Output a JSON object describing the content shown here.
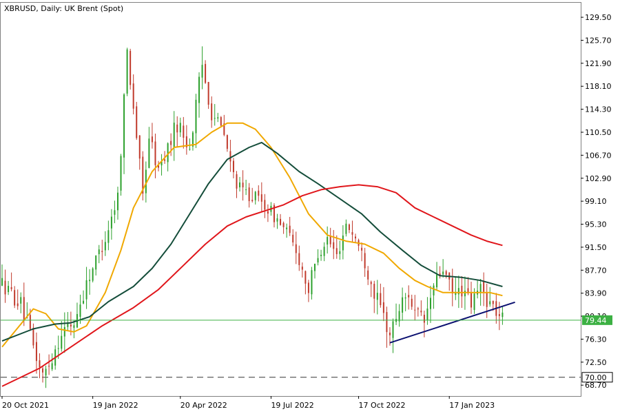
{
  "chart_data": {
    "type": "candlestick",
    "title": "XBRUSD, Daily:  UK Brent (Spot)",
    "x_tick_labels": [
      "20 Oct 2021",
      "19 Jan 2022",
      "20 Apr 2022",
      "19 Jul 2022",
      "17 Oct 2022",
      "17 Jan 2023"
    ],
    "y_tick_labels": [
      "129.50",
      "125.70",
      "121.90",
      "118.10",
      "114.30",
      "110.50",
      "106.70",
      "102.90",
      "99.10",
      "95.30",
      "91.50",
      "87.70",
      "83.90",
      "80.10",
      "76.30",
      "72.50",
      "68.70"
    ],
    "ylim": [
      66.9,
      131.9
    ],
    "price_tag": {
      "label": "79.44",
      "value": 79.44
    },
    "level_tag": {
      "label": "70.00",
      "value": 70.0
    },
    "colors": {
      "bull": "#2ca02c",
      "bear": "#c0392b",
      "ma_fast": "#f0a800",
      "ma_mid": "#144d3a",
      "ma_slow": "#e0161b",
      "trendline": "#0b1070",
      "price_line": "#3cb043",
      "level_line": "#333333"
    },
    "price_path": [
      [
        0,
        85.5
      ],
      [
        6,
        82.0
      ],
      [
        10,
        75.0
      ],
      [
        13,
        70.0
      ],
      [
        16,
        73.5
      ],
      [
        19,
        77.5
      ],
      [
        23,
        79.0
      ],
      [
        28,
        87.0
      ],
      [
        33,
        93.0
      ],
      [
        37,
        100.0
      ],
      [
        40,
        124.0
      ],
      [
        42,
        115.0
      ],
      [
        45,
        100.0
      ],
      [
        47,
        110.0
      ],
      [
        50,
        104.0
      ],
      [
        53,
        108.0
      ],
      [
        56,
        112.0
      ],
      [
        60,
        108.0
      ],
      [
        64,
        121.5
      ],
      [
        67,
        114.0
      ],
      [
        71,
        110.0
      ],
      [
        73,
        105.0
      ],
      [
        76,
        101.0
      ],
      [
        80,
        100.0
      ],
      [
        84,
        98.5
      ],
      [
        88,
        96.0
      ],
      [
        91,
        94.0
      ],
      [
        94,
        91.0
      ],
      [
        98,
        84.5
      ],
      [
        101,
        90.5
      ],
      [
        104,
        93.0
      ],
      [
        107,
        90.0
      ],
      [
        110,
        95.5
      ],
      [
        113,
        93.0
      ],
      [
        116,
        89.0
      ],
      [
        119,
        84.0
      ],
      [
        122,
        80.0
      ],
      [
        124,
        77.0
      ],
      [
        127,
        81.5
      ],
      [
        130,
        84.0
      ],
      [
        132,
        80.5
      ],
      [
        135,
        79.0
      ],
      [
        138,
        85.0
      ],
      [
        141,
        88.0
      ],
      [
        144,
        83.5
      ],
      [
        147,
        84.5
      ],
      [
        150,
        82.0
      ],
      [
        153,
        85.0
      ],
      [
        155,
        83.0
      ],
      [
        158,
        81.0
      ],
      [
        160,
        79.44
      ]
    ],
    "moving_averages": [
      {
        "role": "fast",
        "points": [
          [
            0,
            75.0
          ],
          [
            10,
            81.3
          ],
          [
            14,
            80.5
          ],
          [
            18,
            78.0
          ],
          [
            23,
            77.5
          ],
          [
            27,
            78.5
          ],
          [
            33,
            84.0
          ],
          [
            38,
            91.0
          ],
          [
            42,
            98.0
          ],
          [
            48,
            104.0
          ],
          [
            55,
            108.0
          ],
          [
            62,
            108.5
          ],
          [
            67,
            110.5
          ],
          [
            72,
            112.0
          ],
          [
            77,
            112.0
          ],
          [
            81,
            111.0
          ],
          [
            86,
            108.0
          ],
          [
            92,
            103.0
          ],
          [
            98,
            97.0
          ],
          [
            104,
            93.5
          ],
          [
            110,
            92.5
          ],
          [
            116,
            92.0
          ],
          [
            122,
            90.5
          ],
          [
            127,
            88.0
          ],
          [
            132,
            86.0
          ],
          [
            136,
            85.0
          ],
          [
            141,
            84.0
          ],
          [
            146,
            84.0
          ],
          [
            151,
            84.0
          ],
          [
            156,
            84.0
          ],
          [
            160,
            83.5
          ]
        ]
      },
      {
        "role": "mid",
        "points": [
          [
            0,
            76.0
          ],
          [
            10,
            78.0
          ],
          [
            17,
            78.8
          ],
          [
            22,
            79.0
          ],
          [
            28,
            80.0
          ],
          [
            34,
            82.5
          ],
          [
            42,
            85.0
          ],
          [
            48,
            88.0
          ],
          [
            54,
            92.0
          ],
          [
            60,
            97.0
          ],
          [
            66,
            102.0
          ],
          [
            72,
            106.0
          ],
          [
            79,
            108.0
          ],
          [
            83,
            108.8
          ],
          [
            88,
            107.0
          ],
          [
            95,
            104.0
          ],
          [
            101,
            102.0
          ],
          [
            108,
            99.5
          ],
          [
            115,
            97.0
          ],
          [
            121,
            94.0
          ],
          [
            128,
            91.0
          ],
          [
            134,
            88.5
          ],
          [
            140,
            86.8
          ],
          [
            147,
            86.5
          ],
          [
            153,
            86.0
          ],
          [
            160,
            85.0
          ]
        ]
      },
      {
        "role": "slow",
        "points": [
          [
            0,
            68.5
          ],
          [
            12,
            71.5
          ],
          [
            22,
            75.0
          ],
          [
            32,
            78.5
          ],
          [
            42,
            81.5
          ],
          [
            50,
            84.5
          ],
          [
            58,
            88.5
          ],
          [
            65,
            92.0
          ],
          [
            72,
            95.0
          ],
          [
            78,
            96.5
          ],
          [
            84,
            97.5
          ],
          [
            90,
            98.5
          ],
          [
            96,
            100.0
          ],
          [
            102,
            101.0
          ],
          [
            108,
            101.5
          ],
          [
            114,
            101.8
          ],
          [
            120,
            101.5
          ],
          [
            126,
            100.5
          ],
          [
            132,
            98.0
          ],
          [
            138,
            96.5
          ],
          [
            144,
            95.0
          ],
          [
            150,
            93.5
          ],
          [
            155,
            92.5
          ],
          [
            160,
            91.8
          ]
        ]
      }
    ],
    "trendline": [
      [
        124,
        75.7
      ],
      [
        164,
        82.4
      ]
    ]
  }
}
